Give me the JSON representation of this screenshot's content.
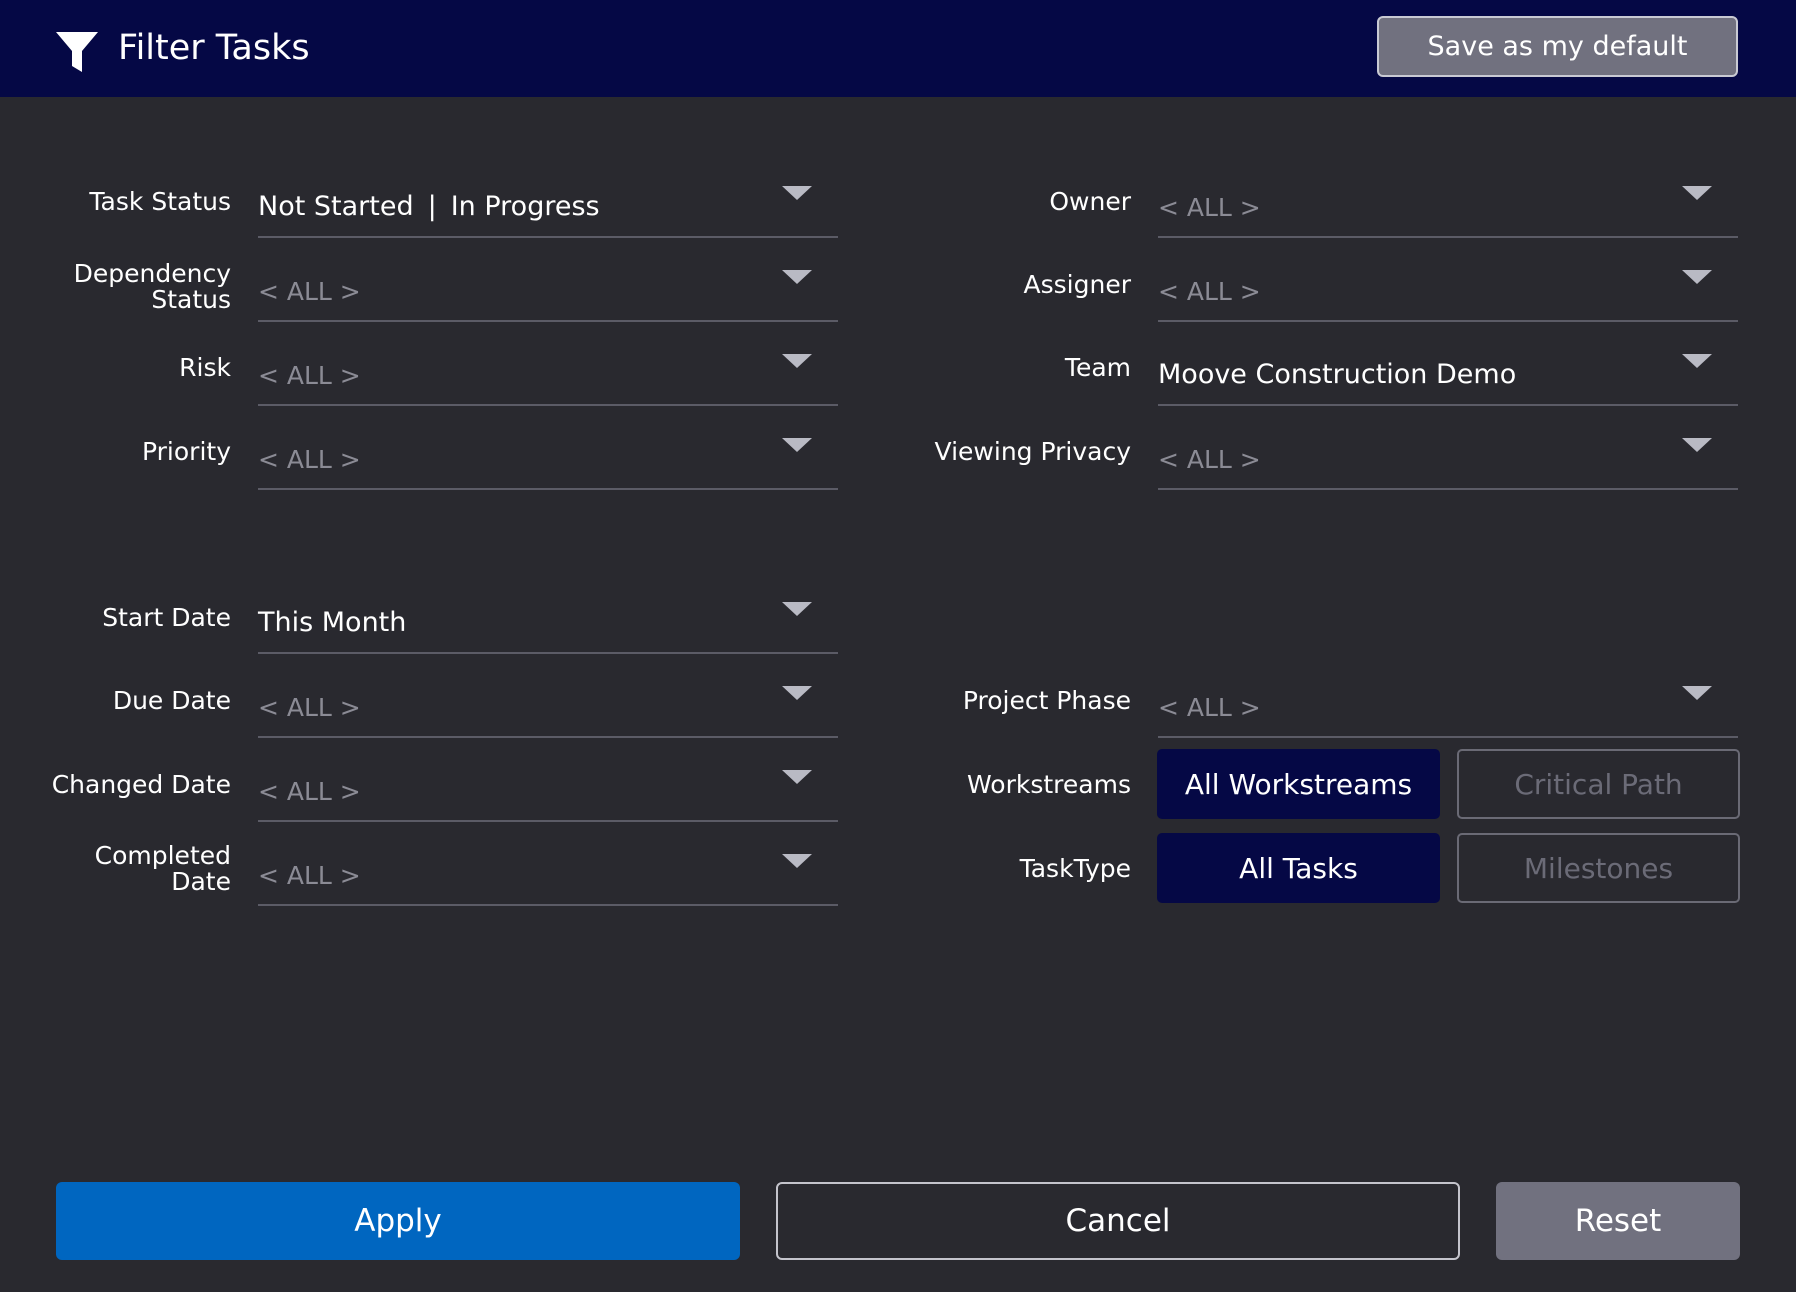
{
  "header": {
    "title": "Filter Tasks",
    "save_default_label": "Save as my default"
  },
  "left_fields": [
    {
      "label": "Task Status",
      "value": "Not Started",
      "value2": "In Progress",
      "separator": "|"
    },
    {
      "label_line1": "Dependency",
      "label_line2": "Status",
      "value": "< ALL >"
    },
    {
      "label": "Risk",
      "value": "< ALL >"
    },
    {
      "label": "Priority",
      "value": "< ALL >"
    },
    {
      "label": "Start Date",
      "value": "This Month"
    },
    {
      "label": "Due Date",
      "value": "< ALL >"
    },
    {
      "label": "Changed Date",
      "value": "< ALL >"
    },
    {
      "label_line1": "Completed",
      "label_line2": "Date",
      "value": "< ALL >"
    }
  ],
  "right_fields": [
    {
      "label": "Owner",
      "value": "< ALL >"
    },
    {
      "label": "Assigner",
      "value": "< ALL >"
    },
    {
      "label": "Team",
      "value": "Moove Construction Demo"
    },
    {
      "label": "Viewing Privacy",
      "value": "< ALL >"
    },
    {
      "label": "Project Phase",
      "value": "< ALL >"
    }
  ],
  "workstreams": {
    "label": "Workstreams",
    "options": [
      "All Workstreams",
      "Critical Path"
    ],
    "selected": "All Workstreams"
  },
  "tasktype": {
    "label": "TaskType",
    "options": [
      "All Tasks",
      "Milestones"
    ],
    "selected": "All Tasks"
  },
  "footer": {
    "apply_label": "Apply",
    "cancel_label": "Cancel",
    "reset_label": "Reset"
  },
  "colors": {
    "background": "#29292f",
    "header": "#050845",
    "accent_blue": "#0066c0",
    "active_toggle": "#050845",
    "muted_button": "#71717f"
  },
  "icons": {
    "filter": "filter-icon",
    "dropdown": "caret-down-icon"
  }
}
